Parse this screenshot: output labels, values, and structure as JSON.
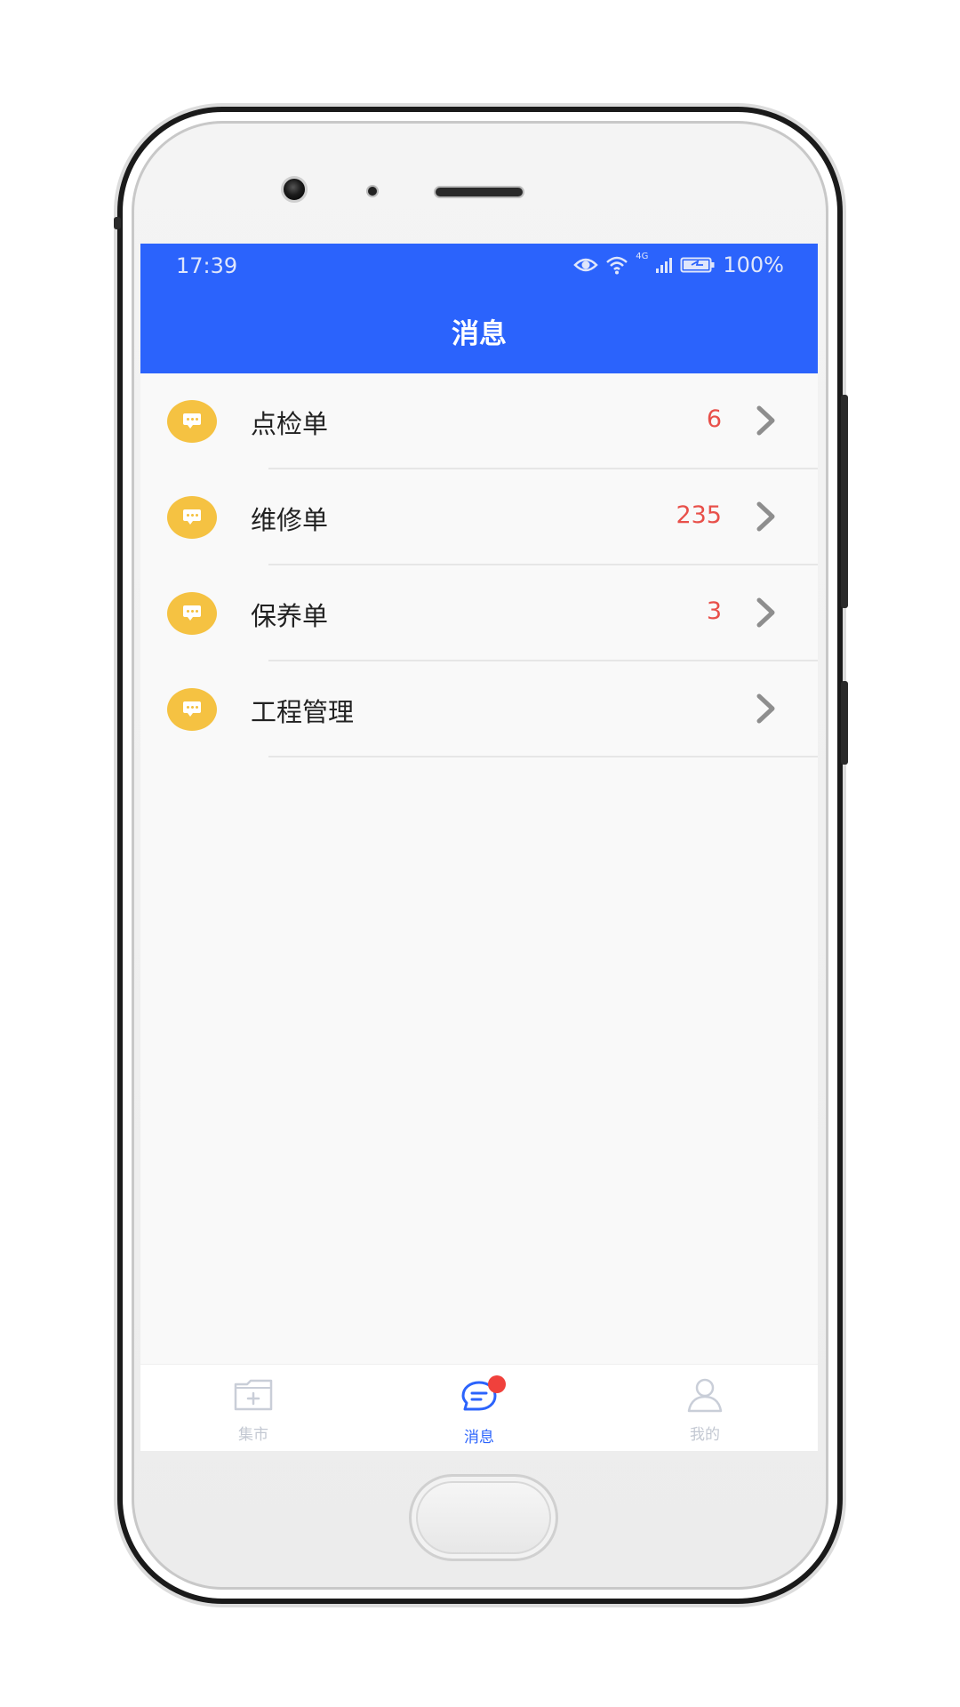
{
  "status_bar": {
    "time": "17:39",
    "network": "4G",
    "battery": "100%",
    "icons": [
      "eye-icon",
      "wifi-icon",
      "signal-icon",
      "battery-icon"
    ]
  },
  "header": {
    "title": "消息",
    "background": "#2b63fc"
  },
  "messages": [
    {
      "label": "点检单",
      "count": "6",
      "icon": "chat-bubble-icon"
    },
    {
      "label": "维修单",
      "count": "235",
      "icon": "chat-bubble-icon"
    },
    {
      "label": "保养单",
      "count": "3",
      "icon": "chat-bubble-icon"
    },
    {
      "label": "工程管理",
      "count": "",
      "icon": "chat-bubble-icon"
    }
  ],
  "tab_bar": {
    "tabs": [
      {
        "label": "集市",
        "icon": "folder-plus-icon",
        "active": false
      },
      {
        "label": "消息",
        "icon": "message-icon",
        "active": true
      },
      {
        "label": "我的",
        "icon": "user-icon",
        "active": false
      }
    ]
  },
  "colors": {
    "accent": "#2b63fc",
    "count": "#e8504a",
    "icon_bg": "#f5c242",
    "badge": "#f0413c"
  }
}
